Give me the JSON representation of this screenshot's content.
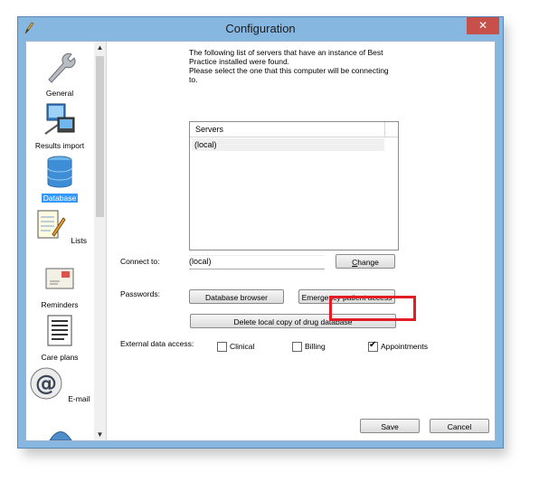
{
  "window": {
    "title": "Configuration",
    "close_glyph": "✕"
  },
  "sidebar": {
    "items": [
      {
        "label": "General",
        "icon": "wrench-icon",
        "selected": false
      },
      {
        "label": "Results import",
        "icon": "computer-network-icon",
        "selected": false
      },
      {
        "label": "Database",
        "icon": "database-icon",
        "selected": true
      },
      {
        "label": "Lists",
        "icon": "notepad-icon",
        "selected": false
      },
      {
        "label": "Reminders",
        "icon": "envelope-icon",
        "selected": false
      },
      {
        "label": "Care plans",
        "icon": "document-list-icon",
        "selected": false
      },
      {
        "label": "E-mail",
        "icon": "at-sign-icon",
        "selected": false
      }
    ],
    "scroll_up": "▲",
    "scroll_down": "▼"
  },
  "main": {
    "intro_line1": "The following list of servers that have an instance of Best",
    "intro_line2": "Practice installed were found.",
    "intro_line3": "Please select the one that this computer will be connecting",
    "intro_line4": "to.",
    "servers_header": "Servers",
    "servers": [
      "(local)"
    ],
    "connect_label": "Connect to:",
    "connect_value": "(local)",
    "change_button": "Change",
    "passwords_label": "Passwords:",
    "db_browser_button": "Database browser",
    "emergency_button": "Emergency patient access",
    "delete_button": "Delete local copy of drug database",
    "external_label": "External data access:",
    "clinical_label": "Clinical",
    "clinical_checked": false,
    "billing_label": "Billing",
    "billing_checked": false,
    "appointments_label": "Appointments",
    "appointments_checked": true,
    "check_glyph": "✔",
    "save_button": "Save",
    "cancel_button": "Cancel"
  }
}
